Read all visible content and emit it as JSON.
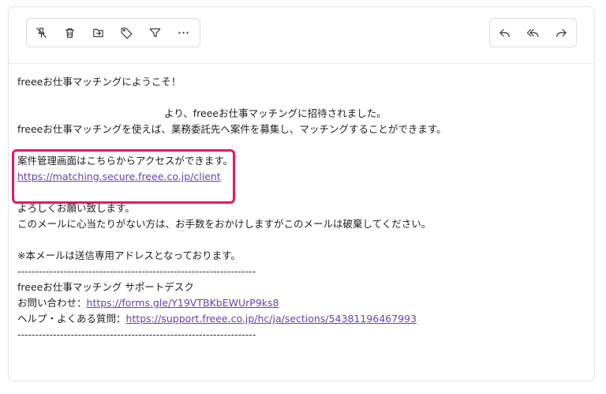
{
  "toolbar": {
    "left_icons": [
      "archive-off-icon",
      "trash-icon",
      "move-to-folder-icon",
      "tag-icon",
      "filter-icon",
      "more-icon"
    ],
    "right_icons": [
      "reply-icon",
      "reply-all-icon",
      "forward-icon"
    ]
  },
  "email": {
    "greeting": "freeeお仕事マッチングにようこそ！",
    "invite_line": "より、freeeお仕事マッチングに招待されました。",
    "description": "freeeお仕事マッチングを使えば、業務委託先へ案件を募集し、マッチングすることができます。",
    "access_text": "案件管理画面はこちらからアクセスができます。",
    "access_link": "https://matching.secure.freee.co.jp/client",
    "regards": "よろしくお願い致します。",
    "ignore_notice": "このメールに心当たりがない方は、お手数をおかけしますがこのメールは破棄してください。",
    "send_only_notice": "※本メールは送信専用アドレスとなっております。",
    "divider": "-------------------------------------------------------------------",
    "support_title": "freeeお仕事マッチング サポートデスク",
    "contact_label": "お問い合わせ：",
    "contact_link": "https://forms.gle/Y19VTBKbEWUrP9ks8",
    "faq_label": "ヘルプ・よくある質問：",
    "faq_link": "https://support.freee.co.jp/hc/ja/sections/54381196467993"
  },
  "colors": {
    "highlight": "#e8175d",
    "link": "#6b3fb0"
  }
}
